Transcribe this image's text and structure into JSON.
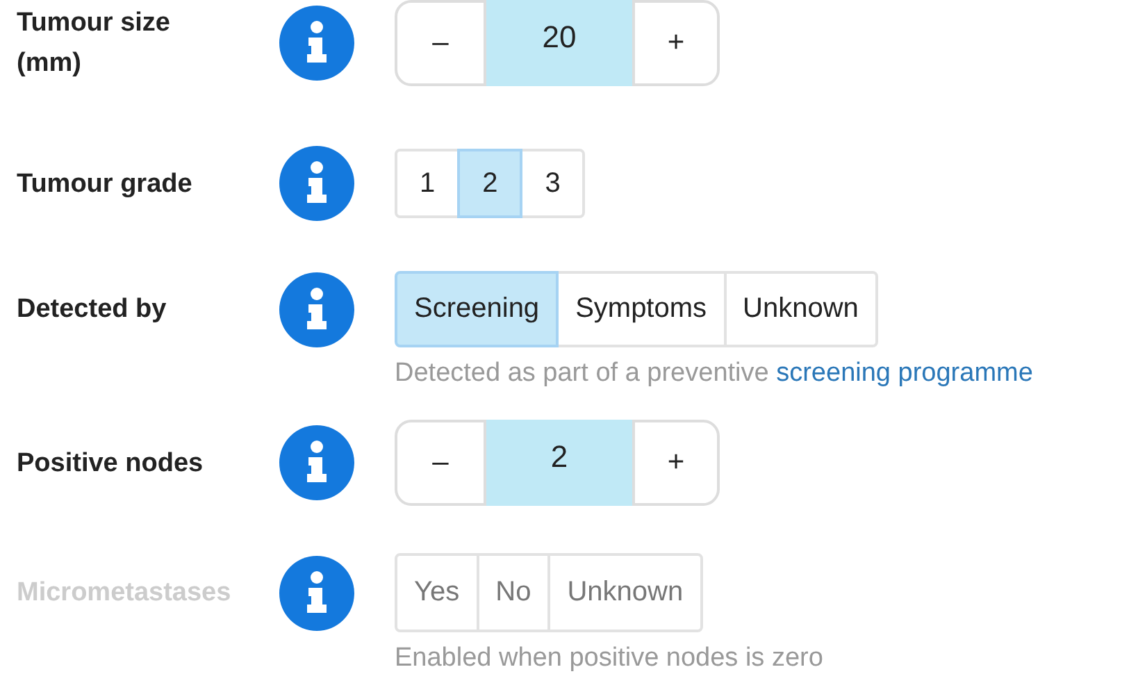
{
  "fields": [
    {
      "label": "Tumour size (mm)",
      "kind": "stepper",
      "disabled": false,
      "minus": "–",
      "value": "20",
      "plus": "+"
    },
    {
      "label": "Tumour grade",
      "kind": "choice",
      "disabled": false,
      "options": [
        {
          "label": "1",
          "selected": false
        },
        {
          "label": "2",
          "selected": true
        },
        {
          "label": "3",
          "selected": false
        }
      ]
    },
    {
      "label": "Detected by",
      "kind": "choice",
      "disabled": false,
      "options": [
        {
          "label": "Screening",
          "selected": true
        },
        {
          "label": "Symptoms",
          "selected": false
        },
        {
          "label": "Unknown",
          "selected": false
        }
      ],
      "help": {
        "text": "Detected as part of a preventive ",
        "link": "screening programme"
      }
    },
    {
      "label": "Positive nodes",
      "kind": "stepper",
      "disabled": false,
      "minus": "–",
      "value": "2",
      "plus": "+"
    },
    {
      "label": "Micrometastases",
      "kind": "choice",
      "disabled": true,
      "options": [
        {
          "label": "Yes",
          "selected": false
        },
        {
          "label": "No",
          "selected": false
        },
        {
          "label": "Unknown",
          "selected": false
        }
      ],
      "help": {
        "text": "Enabled when positive nodes is zero"
      }
    }
  ]
}
